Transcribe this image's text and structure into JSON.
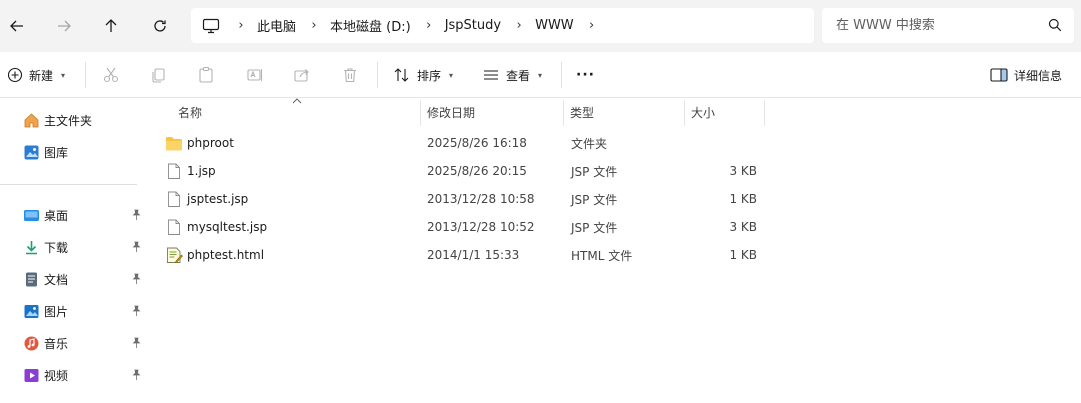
{
  "nav": {
    "back_icon": "arrow-left-icon",
    "forward_icon": "arrow-right-icon",
    "up_icon": "arrow-up-icon",
    "refresh_icon": "refresh-icon"
  },
  "breadcrumb": [
    "此电脑",
    "本地磁盘 (D:)",
    "JspStudy",
    "WWW"
  ],
  "search": {
    "placeholder": "在 WWW 中搜索"
  },
  "toolbar": {
    "new_label": "新建",
    "sort_label": "排序",
    "view_label": "查看",
    "more_label": "···",
    "details_label": "详细信息"
  },
  "sidebar": {
    "top": [
      {
        "label": "主文件夹",
        "icon": "home-icon"
      },
      {
        "label": "图库",
        "icon": "gallery-icon"
      }
    ],
    "pinned": [
      {
        "label": "桌面",
        "icon": "desktop-icon"
      },
      {
        "label": "下载",
        "icon": "download-icon"
      },
      {
        "label": "文档",
        "icon": "documents-icon"
      },
      {
        "label": "图片",
        "icon": "pictures-icon"
      },
      {
        "label": "音乐",
        "icon": "music-icon"
      },
      {
        "label": "视频",
        "icon": "videos-icon"
      }
    ]
  },
  "columns": {
    "name": "名称",
    "date": "修改日期",
    "type": "类型",
    "size": "大小"
  },
  "files": [
    {
      "name": "phproot",
      "date": "2025/8/26 16:18",
      "type": "文件夹",
      "size": "",
      "icon": "folder-icon"
    },
    {
      "name": "1.jsp",
      "date": "2025/8/26 20:15",
      "type": "JSP 文件",
      "size": "3 KB",
      "icon": "file-icon"
    },
    {
      "name": "jsptest.jsp",
      "date": "2013/12/28 10:58",
      "type": "JSP 文件",
      "size": "1 KB",
      "icon": "file-icon"
    },
    {
      "name": "mysqltest.jsp",
      "date": "2013/12/28 10:52",
      "type": "JSP 文件",
      "size": "3 KB",
      "icon": "file-icon"
    },
    {
      "name": "phptest.html",
      "date": "2014/1/1 15:33",
      "type": "HTML 文件",
      "size": "1 KB",
      "icon": "html-file-icon"
    }
  ],
  "colors": {
    "accent": "#0067c0",
    "folder": "#f8c542",
    "chrome_bg": "#f3f3f3"
  }
}
